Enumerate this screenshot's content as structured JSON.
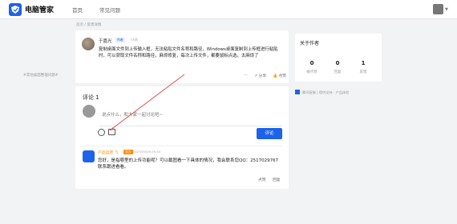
{
  "app": {
    "name": "电脑管家"
  },
  "nav": [
    "首页",
    "常见问题"
  ],
  "breadcrumb": "首页 / 反馈详情",
  "post": {
    "user": "于嘉光",
    "badge": "作者",
    "time": "7天前",
    "body": "复制桌面文件到上传输入框，无法粘贴文件名称和路径，Windows桌面复制到上传框进行粘贴时，可以获取文件名称和路径，麻烦修复，每次上传文件，都要鼠标点选，太麻烦了",
    "tag": "#其他桌面整理问题#",
    "actions": {
      "more": "…",
      "share": "分享",
      "like": "点赞"
    }
  },
  "comments": {
    "title": "评论 1",
    "placeholder": "说点什么，和大家一起讨论吧~",
    "submit_label": "评论",
    "reply": {
      "user": "产品运营 飞",
      "badge": "官方",
      "time": "2023/09/26 09:40",
      "text": "您好，是指哪里的上传功能呢？可以截图看一下具体的情况，我会联系您QQ：2517029767联系跟进看看。",
      "like": "点赞",
      "more": "回复"
    }
  },
  "author": {
    "title": "关于作者",
    "stats": [
      {
        "value": "0",
        "label": "被点赞"
      },
      {
        "value": "0",
        "label": "回复"
      },
      {
        "value": "1",
        "label": "反馈"
      }
    ]
  },
  "service_note": "腾讯客服 | 提供支持 · 产品体验",
  "colors": {
    "brand": "#1d63ea",
    "official": "#ff8a00",
    "annotation": "#d9534f"
  }
}
